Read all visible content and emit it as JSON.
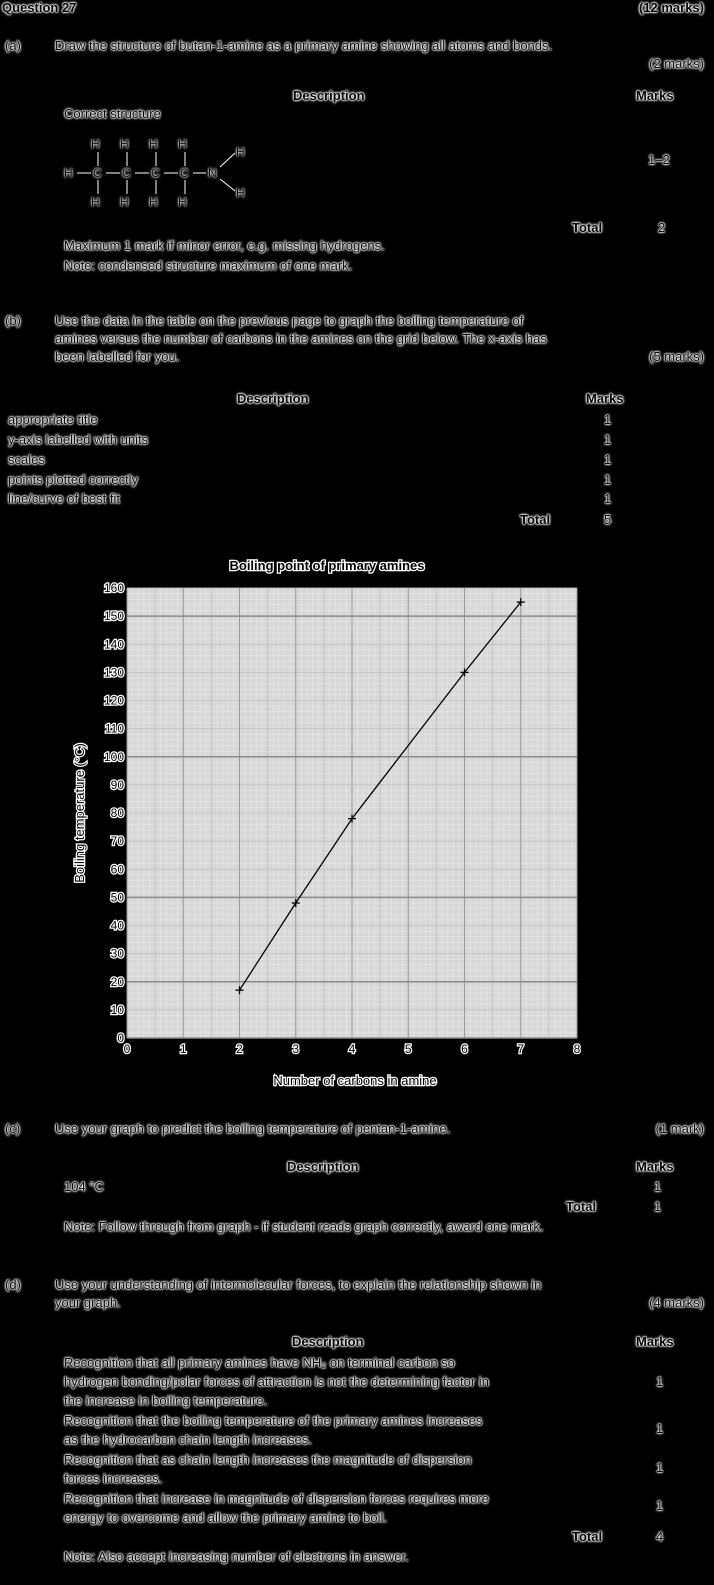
{
  "question": {
    "title": "Question 27",
    "marks": "(12 marks)"
  },
  "part_a": {
    "label": "(a)",
    "prompt": "Draw the structure of butan-1-amine as a primary amine showing all atoms and bonds.",
    "marks": "(2 marks)",
    "desc_header": "Description",
    "marks_header": "Marks",
    "row1": "Correct structure",
    "row1_marks": "1–2",
    "total_label": "Total",
    "total": "2",
    "note1": "Maximum 1 mark if minor error, e.g. missing hydrogens.",
    "note2": "Note: condensed structure maximum of one mark.",
    "structure": {
      "H": "H",
      "C": "C",
      "N": "N"
    }
  },
  "part_b": {
    "label": "(b)",
    "prompt_line1": "Use the data in the table on the previous page to graph the boiling temperature of",
    "prompt_line2": "amines versus the number of carbons in the amines on the grid below. The x-axis has",
    "prompt_line3": "been labelled for you.",
    "marks": "(5 marks)",
    "desc_header": "Description",
    "marks_header": "Marks",
    "rows": [
      {
        "desc": "appropriate title",
        "mark": "1"
      },
      {
        "desc": "y-axis labelled with units",
        "mark": "1"
      },
      {
        "desc": "scales",
        "mark": "1"
      },
      {
        "desc": "points plotted correctly",
        "mark": "1"
      },
      {
        "desc": "line/curve of best fit",
        "mark": "1"
      }
    ],
    "total_label": "Total",
    "total": "5"
  },
  "chart_data": {
    "type": "line",
    "title": "Boiling point of primary amines",
    "xlabel": "Number of carbons in amine",
    "ylabel": "Boiling temperature (°C)",
    "xlim": [
      0,
      8
    ],
    "ylim": [
      0,
      160
    ],
    "x_ticks": [
      "0",
      "1",
      "2",
      "3",
      "4",
      "5",
      "6",
      "7",
      "8"
    ],
    "y_ticks": [
      "0",
      "10",
      "20",
      "30",
      "40",
      "50",
      "60",
      "70",
      "80",
      "90",
      "100",
      "110",
      "120",
      "130",
      "140",
      "150",
      "160"
    ],
    "x": [
      2,
      3,
      4,
      6,
      7
    ],
    "y": [
      17,
      48,
      78,
      130,
      155
    ],
    "grid": true
  },
  "part_c": {
    "label": "(c)",
    "prompt": "Use your graph to predict the boiling temperature of pentan-1-amine.",
    "marks": "(1 mark)",
    "desc_header": "Description",
    "marks_header": "Marks",
    "row1": "104 °C",
    "row1_marks": "1",
    "total_label": "Total",
    "total": "1",
    "note": "Note: Follow through from graph - if student reads graph correctly, award one mark."
  },
  "part_d": {
    "label": "(d)",
    "prompt_line1": "Use your understanding of intermolecular forces, to explain the relationship shown in",
    "prompt_line2": "your graph.",
    "marks": "(4 marks)",
    "desc_header": "Description",
    "marks_header": "Marks",
    "rows": [
      {
        "lines": [
          "Recognition that all primary amines have NH₂ on terminal carbon so",
          "hydrogen bonding/polar forces of attraction is not the determining factor in",
          "the increase in boiling temperature."
        ],
        "mark": "1"
      },
      {
        "lines": [
          "Recognition that the boiling temperature of the primary amines increases",
          "as the hydrocarbon chain length increases."
        ],
        "mark": "1"
      },
      {
        "lines": [
          "Recognition that as chain length increases the magnitude of dispersion",
          "forces increases."
        ],
        "mark": "1"
      },
      {
        "lines": [
          "Recognition that increase in magnitude of dispersion forces requires more",
          "energy to overcome and allow the primary amine to boil."
        ],
        "mark": "1"
      }
    ],
    "total_label": "Total",
    "total": "4",
    "note": "Note: Also accept increasing number of electrons in answer."
  }
}
